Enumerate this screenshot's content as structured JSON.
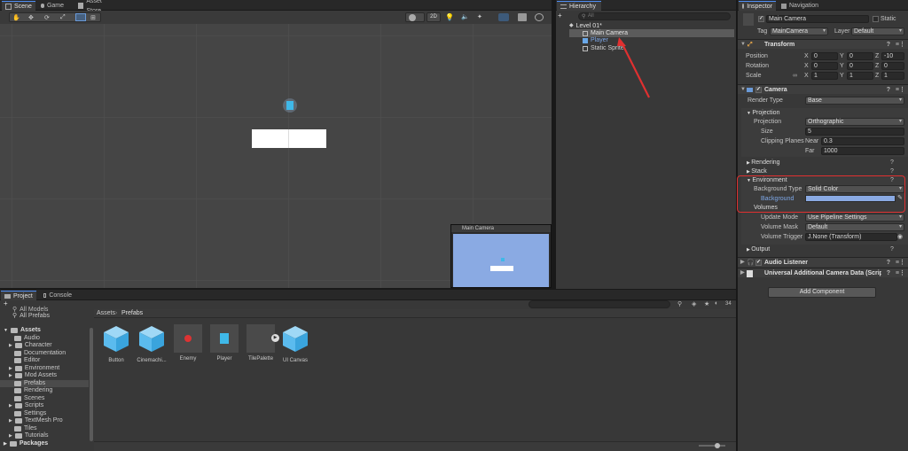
{
  "scene_tabs": [
    {
      "label": "Scene",
      "icon": "grid-icon"
    },
    {
      "label": "Game",
      "icon": "gamepad-icon"
    },
    {
      "label": "Asset Store",
      "icon": "store-icon"
    }
  ],
  "scene_toolbar": {
    "mode_2d_label": "2D"
  },
  "hierarchy": {
    "tab_label": "Hierarchy",
    "add_label": "+",
    "search_placeholder": "All",
    "scene_name": "Level 01*",
    "items": [
      {
        "label": "Main Camera",
        "icon": "cube-icon",
        "color": "#d0d0d0",
        "selected": true
      },
      {
        "label": "Player",
        "icon": "prefab-cube-icon",
        "color": "#7ea8e8",
        "selected": false
      },
      {
        "label": "Static Sprite",
        "icon": "cube-icon",
        "color": "#d0d0d0",
        "selected": false
      }
    ]
  },
  "camera_preview": {
    "title": "Main Camera",
    "bg_color": "#8aaae3"
  },
  "inspector": {
    "tabs": [
      "Inspector",
      "Navigation"
    ],
    "object_name": "Main Camera",
    "static_label": "Static",
    "tag_label": "Tag",
    "tag_value": "MainCamera",
    "layer_label": "Layer",
    "layer_value": "Default",
    "transform": {
      "title": "Transform",
      "rows": [
        {
          "label": "Position",
          "x": "0",
          "y": "0",
          "z": "-10"
        },
        {
          "label": "Rotation",
          "x": "0",
          "y": "0",
          "z": "0"
        },
        {
          "label": "Scale",
          "x": "1",
          "y": "1",
          "z": "1"
        }
      ],
      "axis_labels": [
        "X",
        "Y",
        "Z"
      ]
    },
    "camera": {
      "title": "Camera",
      "render_type_label": "Render Type",
      "render_type_value": "Base",
      "projection_section": "Projection",
      "projection_label": "Projection",
      "projection_value": "Orthographic",
      "size_label": "Size",
      "size_value": "5",
      "clipping_label": "Clipping Planes",
      "near_label": "Near",
      "near_value": "0.3",
      "far_label": "Far",
      "far_value": "1000",
      "rendering_section": "Rendering",
      "stack_section": "Stack",
      "environment_section": "Environment",
      "background_type_label": "Background Type",
      "background_type_value": "Solid Color",
      "background_label": "Background",
      "background_color": "#8aaae3",
      "volumes_section": "Volumes",
      "update_mode_label": "Update Mode",
      "update_mode_value": "Use Pipeline Settings",
      "volume_mask_label": "Volume Mask",
      "volume_mask_value": "Default",
      "volume_trigger_label": "Volume Trigger",
      "volume_trigger_value": "J.None (Transform)",
      "output_section": "Output"
    },
    "audio_listener_title": "Audio Listener",
    "universal_title": "Universal Additional Camera Data (Scrip",
    "add_component_label": "Add Component"
  },
  "project": {
    "tabs": [
      "Project",
      "Console"
    ],
    "add_label": "+",
    "asset_count": "34",
    "favorites": [
      "All Models",
      "All Prefabs"
    ],
    "root_label": "Assets",
    "folders": [
      "Audio",
      "Character",
      "Documentation",
      "Editor",
      "Environment",
      "Mod Assets",
      "Prefabs",
      "Rendering",
      "Scenes",
      "Scripts",
      "Settings",
      "TextMesh Pro",
      "Tiles",
      "Tutorials"
    ],
    "packages_label": "Packages",
    "breadcrumb": [
      "Assets",
      "Prefabs"
    ],
    "assets": [
      {
        "label": "Button",
        "icon": "prefab-cube-icon"
      },
      {
        "label": "Cinemachi...",
        "icon": "prefab-cube-icon"
      },
      {
        "label": "Enemy",
        "icon": "enemy-sprite-icon"
      },
      {
        "label": "Player",
        "icon": "player-sprite-icon"
      },
      {
        "label": "TilePalette",
        "icon": "tile-palette-icon"
      },
      {
        "label": "UI Canvas",
        "icon": "prefab-cube-icon"
      }
    ]
  },
  "colors": {
    "accent": "#4f8ff7",
    "highlight_box": "#e03030",
    "arrow": "#e03030"
  }
}
